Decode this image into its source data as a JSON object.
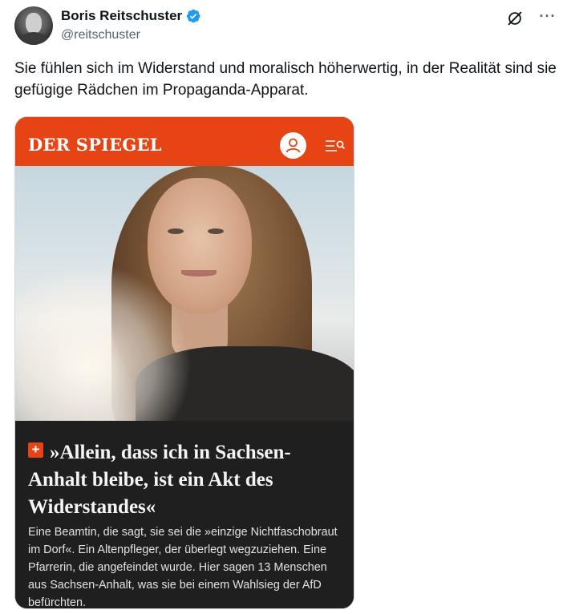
{
  "tweet": {
    "author": {
      "display_name": "Boris Reitschuster",
      "handle": "@reitschuster",
      "verified": true,
      "verified_color": "#1d9bf0"
    },
    "text": "Sie fühlen sich im Widerstand und moralisch höherwertig, in der Realität sind sie gefügige Rädchen im Propaganda-Apparat.",
    "icons": [
      "grok-icon",
      "more-icon"
    ],
    "more_glyph": "···"
  },
  "media": {
    "brand": "DER SPIEGEL",
    "brand_color": "#e64415",
    "icons": [
      "account-icon",
      "menu-search-icon"
    ],
    "plus_badge": "+",
    "headline": "»Allein, dass ich in Sachsen-Anhalt bleibe, ist ein Akt des Widerstandes«",
    "teaser": "Eine Beamtin, die sagt, sie sei die »einzige Nichtfaschobraut im Dorf«. Ein Altenpfleger, der überlegt wegzuziehen. Eine Pfarrerin, die angefeindet wurde. Hier sagen 13 Menschen aus Sachsen-Anhalt, was sie bei einem Wahlsieg der AfD befürchten."
  }
}
